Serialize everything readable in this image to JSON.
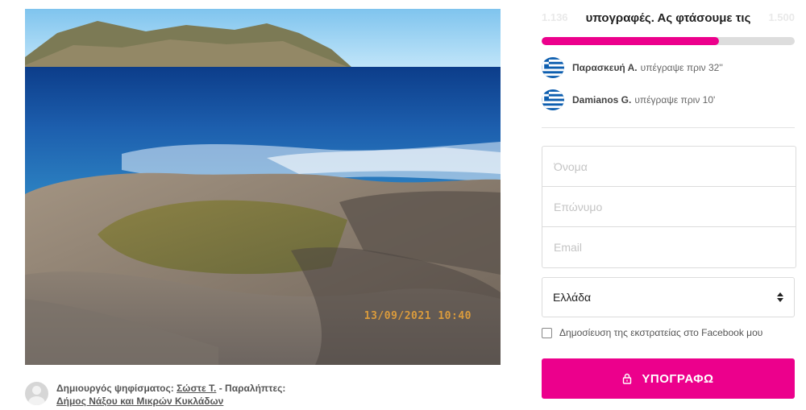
{
  "photo": {
    "stamp": "13/09/2021 10:40",
    "colors": {
      "sky": "#9ed6f3",
      "sea_deep": "#0a3f8c",
      "sea_light": "#2b7fc2",
      "rock": "#8a7b6a"
    }
  },
  "creator": {
    "prefix": "Δημιουργός ψηφίσματος:",
    "name": "Σώστε Τ.",
    "recipients_prefix": " - Παραλήπτες:",
    "recipient": "Δήμος Νάξου και Μικρών Κυκλάδων"
  },
  "goal": {
    "text": "υπογραφές. Ας φτάσουμε τις",
    "faded_left": "1.136",
    "faded_right": "1.500",
    "progress_fraction": 0.7
  },
  "signers": [
    {
      "name": "Παρασκευή Α.",
      "action": "υπέγραψε πριν 32''",
      "flag": "greece-flag-icon"
    },
    {
      "name": "Damianos G.",
      "action": "υπέγραψε πριν 10'",
      "flag": "greece-flag-icon"
    }
  ],
  "form": {
    "first_name_placeholder": "Όνομα",
    "last_name_placeholder": "Επώνυμο",
    "email_placeholder": "Email",
    "country": "Ελλάδα",
    "facebook_share_label": "Δημοσίευση της εκστρατείας στο Facebook μου",
    "sign_button": "ΥΠΟΓΡΑΦΩ"
  },
  "colors": {
    "accent": "#ec008c",
    "progress_track": "#dddddd"
  }
}
